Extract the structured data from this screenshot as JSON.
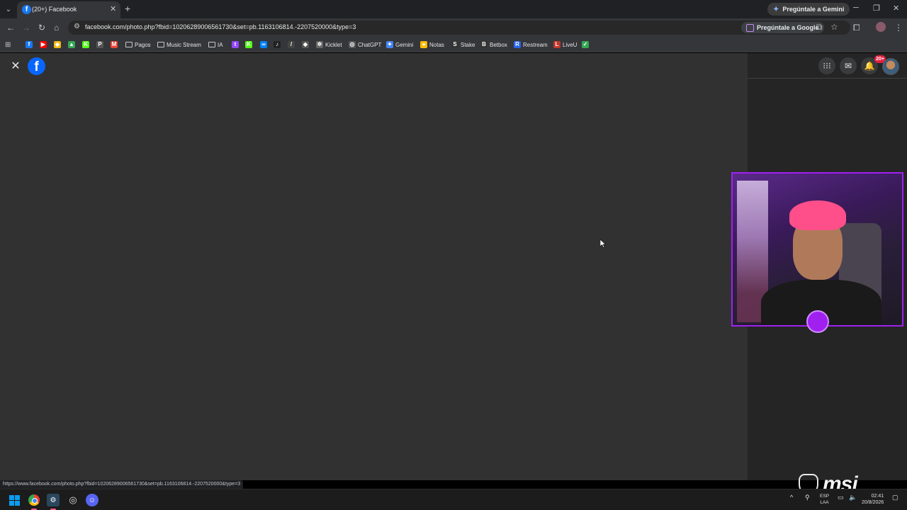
{
  "browser": {
    "tab_title": "(20+) Facebook",
    "tab_favicon": "f",
    "new_tab_glyph": "+",
    "gemini_button": "Pregúntale a Gemini",
    "url": "facebook.com/photo.php?fbid=10206289006561730&set=pb.1163106814.-2207520000&type=3",
    "google_button": "Pregúntale a Google"
  },
  "bookmarks": [
    {
      "icon": "facebook-icon",
      "label": "",
      "color": "#1877f2",
      "glyph": "f"
    },
    {
      "icon": "youtube-icon",
      "label": "",
      "color": "#ff0000",
      "glyph": "▶"
    },
    {
      "icon": "binance-icon",
      "label": "",
      "color": "#f0b90b",
      "glyph": "◆"
    },
    {
      "icon": "drive-icon",
      "label": "",
      "color": "#34a853",
      "glyph": "▲"
    },
    {
      "icon": "kick-icon",
      "label": "",
      "color": "#53fc18",
      "glyph": "K"
    },
    {
      "icon": "pinterest-icon",
      "label": "",
      "color": "#555555",
      "glyph": "P"
    },
    {
      "icon": "gmail-icon",
      "label": "",
      "color": "#ea4335",
      "glyph": "M"
    },
    {
      "icon": "folder-icon",
      "label": "Pagos"
    },
    {
      "icon": "folder-icon",
      "label": "Music Stream"
    },
    {
      "icon": "folder-icon",
      "label": "IA"
    },
    {
      "icon": "twitch-icon",
      "label": "",
      "color": "#9146ff",
      "glyph": "t"
    },
    {
      "icon": "kick-icon",
      "label": "",
      "color": "#53fc18",
      "glyph": "K"
    },
    {
      "icon": "meta-icon",
      "label": "",
      "color": "#0081fb",
      "glyph": "∞"
    },
    {
      "icon": "tiktok-icon",
      "label": "",
      "color": "#222222",
      "glyph": "♪"
    },
    {
      "icon": "grok-icon",
      "label": "",
      "color": "#444444",
      "glyph": "/"
    },
    {
      "icon": "diamond-icon",
      "label": "",
      "color": "#555555",
      "glyph": "◆"
    },
    {
      "icon": "kicklet-icon",
      "label": "Kicklet",
      "color": "#666666",
      "glyph": "✲"
    },
    {
      "icon": "chatgpt-icon",
      "label": "ChatGPT",
      "color": "#555555",
      "glyph": "◎"
    },
    {
      "icon": "gemini-icon",
      "label": "Gemini",
      "color": "#4285f4",
      "glyph": "✦"
    },
    {
      "icon": "notes-icon",
      "label": "Notas",
      "color": "#fbbc05",
      "glyph": "●"
    },
    {
      "icon": "stake-icon",
      "label": "Stake",
      "color": "#333333",
      "glyph": "S"
    },
    {
      "icon": "betbox-icon",
      "label": "Betbox",
      "color": "#333333",
      "glyph": "B"
    },
    {
      "icon": "restream-icon",
      "label": "Restream",
      "color": "#2563eb",
      "glyph": "R"
    },
    {
      "icon": "liveu-icon",
      "label": "LiveU",
      "color": "#c0392b",
      "glyph": "L"
    },
    {
      "icon": "check-icon",
      "label": "",
      "color": "#34a853",
      "glyph": "✓"
    }
  ],
  "facebook": {
    "logo": "f",
    "notification_count": "20+"
  },
  "status_url": "https://www.facebook.com/photo.php?fbid=10206289006561730&set=pb.1163106814.-2207520000&type=3",
  "watermark": "msi",
  "taskbar": {
    "lang_top": "ESP",
    "lang_bottom": "LAA",
    "time": "02:41",
    "date": "20/8/2026"
  }
}
